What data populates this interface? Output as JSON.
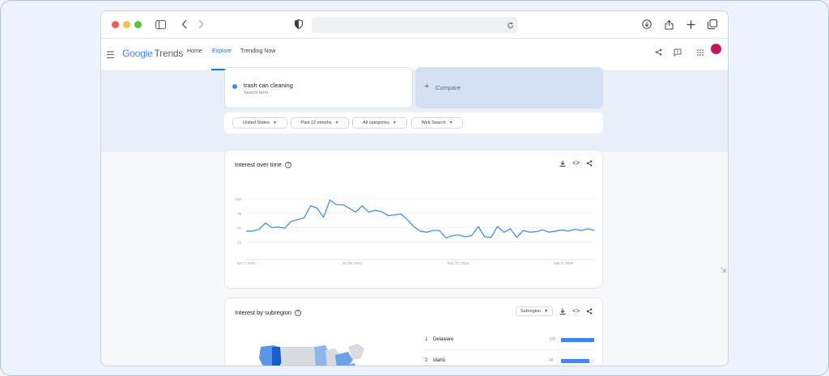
{
  "search": {
    "term": "trash can cleaning",
    "subtitle": "Search term"
  },
  "compare": {
    "plus": "+",
    "label": "Compare"
  },
  "nav": {
    "logo_google": "Google",
    "logo_trends": "Trends",
    "home": "Home",
    "explore": "Explore",
    "trending": "Trending Now"
  },
  "filters": [
    {
      "label": "United States",
      "caret": "▼"
    },
    {
      "label": "Past 12 months",
      "caret": "▼"
    },
    {
      "label": "All categories",
      "caret": "▼"
    },
    {
      "label": "Web Search",
      "caret": "▼"
    }
  ],
  "interest_over_time": {
    "title": "Interest over time",
    "help": "?"
  },
  "interest_by_subregion": {
    "title": "Interest by subregion",
    "help": "?",
    "select_label": "Subregion",
    "select_caret": "▼",
    "rows": [
      {
        "rank": "1",
        "name": "Delaware",
        "value": "100",
        "fraction": 1.0
      },
      {
        "rank": "2",
        "name": "Idaho",
        "value": "86",
        "fraction": 0.86
      }
    ]
  },
  "icons": {
    "menu": "☰",
    "download": "⤓",
    "embed": "<>",
    "share": "⋖",
    "feedback": "⚑",
    "apps": "⋮⋮"
  },
  "colors": {
    "accent": "#1a73e8",
    "series": "#4a90d9",
    "avatar": "#c2185b"
  },
  "chart_data": {
    "type": "line",
    "title": "",
    "xlabel": "",
    "ylabel": "",
    "ylim": [
      0,
      100
    ],
    "yticks": [
      "100",
      "75",
      "50",
      "25"
    ],
    "xticks": [
      "Apr 7, 2024",
      "Jul 28, 2024",
      "Nov 17, 2024",
      "Mar 9, 2025"
    ],
    "grid": true,
    "series": [
      {
        "values": [
          44,
          44,
          47,
          58,
          50,
          51,
          49,
          61,
          64,
          67,
          88,
          84,
          68,
          98,
          90,
          90,
          84,
          77,
          88,
          77,
          80,
          78,
          71,
          72,
          74,
          64,
          52,
          44,
          42,
          45,
          45,
          32,
          36,
          37,
          34,
          36,
          52,
          34,
          33,
          52,
          42,
          48,
          33,
          45,
          42,
          43,
          46,
          42,
          44,
          46,
          44,
          47,
          45,
          48,
          45
        ]
      }
    ]
  }
}
